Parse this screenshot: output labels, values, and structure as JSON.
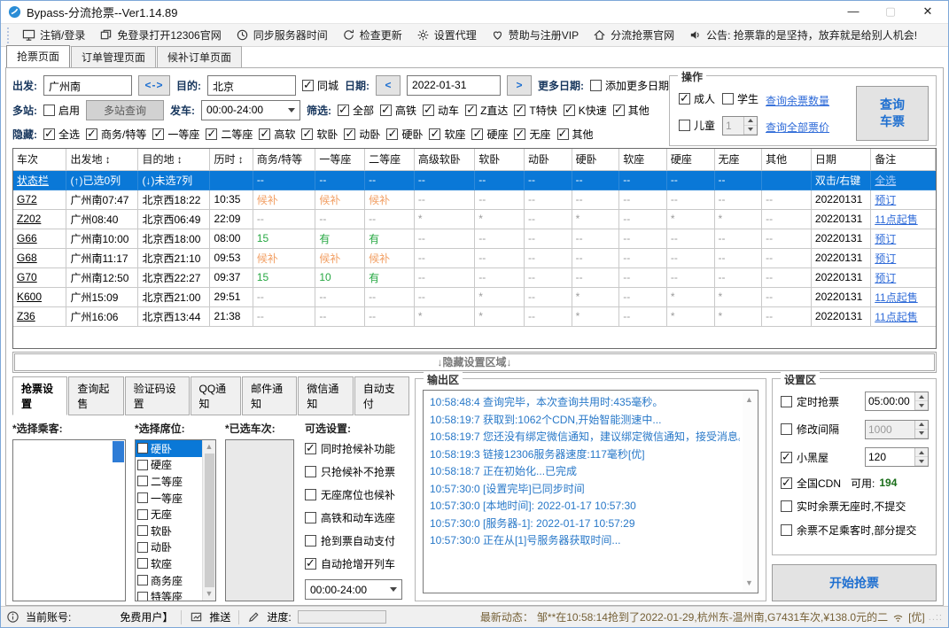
{
  "colors": {
    "accent_blue": "#0a78d7",
    "link_blue": "#2f6bd8",
    "green_avail": "#27a843",
    "orange_waitlist": "#f2a065",
    "label_navy": "#17365d",
    "news_brown": "#756036"
  },
  "window": {
    "title": "Bypass-分流抢票--Ver1.14.89",
    "minimize": "—",
    "maximize": "▢",
    "close": "✕"
  },
  "toolbar": {
    "items": [
      {
        "icon": "monitor",
        "label": "注销/登录"
      },
      {
        "icon": "window",
        "label": "免登录打开12306官网"
      },
      {
        "icon": "clock",
        "label": "同步服务器时间"
      },
      {
        "icon": "refresh",
        "label": "检查更新"
      },
      {
        "icon": "gear",
        "label": "设置代理"
      },
      {
        "icon": "heart",
        "label": "赞助与注册VIP"
      },
      {
        "icon": "home",
        "label": "分流抢票官网"
      },
      {
        "icon": "speaker",
        "label": "公告:  抢票靠的是坚持，放弃就是给别人机会!"
      }
    ]
  },
  "tabs": [
    {
      "label": "抢票页面",
      "active": true
    },
    {
      "label": "订单管理页面",
      "active": false
    },
    {
      "label": "候补订单页面",
      "active": false
    }
  ],
  "query": {
    "depart_label": "出发:",
    "depart_value": "广州南",
    "swap_label": "<->",
    "dest_label": "目的:",
    "dest_value": "北京",
    "same_city": {
      "label": "同城",
      "checked": true
    },
    "date_label": "日期:",
    "date_prev": "<",
    "date_value": "2022-01-31",
    "date_next": ">",
    "more_dates_label": "更多日期:",
    "add_more_dates": {
      "label": "添加更多日期",
      "checked": false
    },
    "multi_label": "多站:",
    "multi_enable": {
      "label": "启用",
      "checked": false
    },
    "multi_query_btn": "多站查询",
    "depart_time_label": "发车:",
    "depart_time_value": "00:00-24:00",
    "filter_label": "筛选:",
    "filters": [
      {
        "label": "全部",
        "checked": true
      },
      {
        "label": "高铁",
        "checked": true
      },
      {
        "label": "动车",
        "checked": true
      },
      {
        "label": "Z直达",
        "checked": true
      },
      {
        "label": "T特快",
        "checked": true
      },
      {
        "label": "K快速",
        "checked": true
      },
      {
        "label": "其他",
        "checked": true
      }
    ],
    "hide_label": "隐藏:",
    "hide_options": [
      {
        "label": "全选",
        "checked": true
      },
      {
        "label": "商务/特等",
        "checked": true
      },
      {
        "label": "一等座",
        "checked": true
      },
      {
        "label": "二等座",
        "checked": true
      },
      {
        "label": "高软",
        "checked": true
      },
      {
        "label": "软卧",
        "checked": true
      },
      {
        "label": "动卧",
        "checked": true
      },
      {
        "label": "硬卧",
        "checked": true
      },
      {
        "label": "软座",
        "checked": true
      },
      {
        "label": "硬座",
        "checked": true
      },
      {
        "label": "无座",
        "checked": true
      },
      {
        "label": "其他",
        "checked": true
      }
    ]
  },
  "operation": {
    "title": "操作",
    "adult": {
      "label": "成人",
      "checked": true
    },
    "student": {
      "label": "学生",
      "checked": false
    },
    "child": {
      "label": "儿童",
      "checked": false
    },
    "child_count": "1",
    "link_check_tickets": "查询余票数量",
    "link_check_prices": "查询全部票价",
    "query_button_line1": "查询",
    "query_button_line2": "车票"
  },
  "table": {
    "headers": [
      "车次",
      "出发地 ↕",
      "目的地 ↕",
      "历时 ↕",
      "商务/特等",
      "一等座",
      "二等座",
      "高级软卧",
      "软卧",
      "动卧",
      "硬卧",
      "软座",
      "硬座",
      "无座",
      "其他",
      "日期",
      "备注"
    ],
    "rows": [
      {
        "selected": true,
        "cells": [
          {
            "t": "状态栏",
            "s": "train"
          },
          {
            "t": "(↑)已选0列"
          },
          {
            "t": "(↓)未选7列"
          },
          {
            "t": ""
          },
          {
            "t": "--"
          },
          {
            "t": "--"
          },
          {
            "t": "--"
          },
          {
            "t": "--"
          },
          {
            "t": "--"
          },
          {
            "t": "--"
          },
          {
            "t": "--"
          },
          {
            "t": "--"
          },
          {
            "t": "--"
          },
          {
            "t": "--"
          },
          {
            "t": ""
          },
          {
            "t": "双击/右键"
          },
          {
            "t": "全选",
            "s": "action"
          }
        ]
      },
      {
        "cells": [
          {
            "t": "G72",
            "s": "train"
          },
          {
            "t": "广州南07:47"
          },
          {
            "t": "北京西18:22"
          },
          {
            "t": "10:35"
          },
          {
            "t": "候补",
            "s": "waitlist"
          },
          {
            "t": "候补",
            "s": "waitlist"
          },
          {
            "t": "候补",
            "s": "waitlist"
          },
          {
            "t": "--",
            "s": "none"
          },
          {
            "t": "--",
            "s": "none"
          },
          {
            "t": "--",
            "s": "none"
          },
          {
            "t": "--",
            "s": "none"
          },
          {
            "t": "--",
            "s": "none"
          },
          {
            "t": "--",
            "s": "none"
          },
          {
            "t": "--",
            "s": "none"
          },
          {
            "t": "--",
            "s": "none"
          },
          {
            "t": "20220131"
          },
          {
            "t": "预订",
            "s": "action"
          }
        ]
      },
      {
        "cells": [
          {
            "t": "Z202",
            "s": "train"
          },
          {
            "t": "广州08:40"
          },
          {
            "t": "北京西06:49"
          },
          {
            "t": "22:09"
          },
          {
            "t": "--",
            "s": "none"
          },
          {
            "t": "--",
            "s": "none"
          },
          {
            "t": "--",
            "s": "none"
          },
          {
            "t": "*",
            "s": "none"
          },
          {
            "t": "*",
            "s": "none"
          },
          {
            "t": "--",
            "s": "none"
          },
          {
            "t": "*",
            "s": "none"
          },
          {
            "t": "--",
            "s": "none"
          },
          {
            "t": "*",
            "s": "none"
          },
          {
            "t": "*",
            "s": "none"
          },
          {
            "t": "--",
            "s": "none"
          },
          {
            "t": "20220131"
          },
          {
            "t": "11点起售",
            "s": "action"
          }
        ]
      },
      {
        "cells": [
          {
            "t": "G66",
            "s": "train"
          },
          {
            "t": "广州南10:00"
          },
          {
            "t": "北京西18:00"
          },
          {
            "t": "08:00"
          },
          {
            "t": "15",
            "s": "avail"
          },
          {
            "t": "有",
            "s": "avail"
          },
          {
            "t": "有",
            "s": "avail"
          },
          {
            "t": "--",
            "s": "none"
          },
          {
            "t": "--",
            "s": "none"
          },
          {
            "t": "--",
            "s": "none"
          },
          {
            "t": "--",
            "s": "none"
          },
          {
            "t": "--",
            "s": "none"
          },
          {
            "t": "--",
            "s": "none"
          },
          {
            "t": "--",
            "s": "none"
          },
          {
            "t": "--",
            "s": "none"
          },
          {
            "t": "20220131"
          },
          {
            "t": "预订",
            "s": "action"
          }
        ]
      },
      {
        "cells": [
          {
            "t": "G68",
            "s": "train"
          },
          {
            "t": "广州南11:17"
          },
          {
            "t": "北京西21:10"
          },
          {
            "t": "09:53"
          },
          {
            "t": "候补",
            "s": "waitlist"
          },
          {
            "t": "候补",
            "s": "waitlist"
          },
          {
            "t": "候补",
            "s": "waitlist"
          },
          {
            "t": "--",
            "s": "none"
          },
          {
            "t": "--",
            "s": "none"
          },
          {
            "t": "--",
            "s": "none"
          },
          {
            "t": "--",
            "s": "none"
          },
          {
            "t": "--",
            "s": "none"
          },
          {
            "t": "--",
            "s": "none"
          },
          {
            "t": "--",
            "s": "none"
          },
          {
            "t": "--",
            "s": "none"
          },
          {
            "t": "20220131"
          },
          {
            "t": "预订",
            "s": "action"
          }
        ]
      },
      {
        "cells": [
          {
            "t": "G70",
            "s": "train"
          },
          {
            "t": "广州南12:50"
          },
          {
            "t": "北京西22:27"
          },
          {
            "t": "09:37"
          },
          {
            "t": "15",
            "s": "avail"
          },
          {
            "t": "10",
            "s": "avail"
          },
          {
            "t": "有",
            "s": "avail"
          },
          {
            "t": "--",
            "s": "none"
          },
          {
            "t": "--",
            "s": "none"
          },
          {
            "t": "--",
            "s": "none"
          },
          {
            "t": "--",
            "s": "none"
          },
          {
            "t": "--",
            "s": "none"
          },
          {
            "t": "--",
            "s": "none"
          },
          {
            "t": "--",
            "s": "none"
          },
          {
            "t": "--",
            "s": "none"
          },
          {
            "t": "20220131"
          },
          {
            "t": "预订",
            "s": "action"
          }
        ]
      },
      {
        "cells": [
          {
            "t": "K600",
            "s": "train"
          },
          {
            "t": "广州15:09"
          },
          {
            "t": "北京西21:00"
          },
          {
            "t": "29:51"
          },
          {
            "t": "--",
            "s": "none"
          },
          {
            "t": "--",
            "s": "none"
          },
          {
            "t": "--",
            "s": "none"
          },
          {
            "t": "--",
            "s": "none"
          },
          {
            "t": "*",
            "s": "none"
          },
          {
            "t": "--",
            "s": "none"
          },
          {
            "t": "*",
            "s": "none"
          },
          {
            "t": "--",
            "s": "none"
          },
          {
            "t": "*",
            "s": "none"
          },
          {
            "t": "*",
            "s": "none"
          },
          {
            "t": "--",
            "s": "none"
          },
          {
            "t": "20220131"
          },
          {
            "t": "11点起售",
            "s": "action"
          }
        ]
      },
      {
        "cells": [
          {
            "t": "Z36",
            "s": "train"
          },
          {
            "t": "广州16:06"
          },
          {
            "t": "北京西13:44"
          },
          {
            "t": "21:38"
          },
          {
            "t": "--",
            "s": "none"
          },
          {
            "t": "--",
            "s": "none"
          },
          {
            "t": "--",
            "s": "none"
          },
          {
            "t": "*",
            "s": "none"
          },
          {
            "t": "*",
            "s": "none"
          },
          {
            "t": "--",
            "s": "none"
          },
          {
            "t": "*",
            "s": "none"
          },
          {
            "t": "--",
            "s": "none"
          },
          {
            "t": "*",
            "s": "none"
          },
          {
            "t": "*",
            "s": "none"
          },
          {
            "t": "--",
            "s": "none"
          },
          {
            "t": "20220131"
          },
          {
            "t": "11点起售",
            "s": "action"
          }
        ]
      }
    ]
  },
  "hide_area_label": "↓隐藏设置区域↓",
  "bottom": {
    "tabs": [
      {
        "label": "抢票设置",
        "active": true
      },
      {
        "label": "查询起售",
        "active": false
      },
      {
        "label": "验证码设置",
        "active": false
      },
      {
        "label": "QQ通知",
        "active": false
      },
      {
        "label": "邮件通知",
        "active": false
      },
      {
        "label": "微信通知",
        "active": false
      },
      {
        "label": "自动支付",
        "active": false
      }
    ],
    "passengers_label": "*选择乘客:",
    "seats_label": "*选择席位:",
    "trains_label": "*已选车次:",
    "options_label": "可选设置:",
    "seats": [
      {
        "label": "硬卧",
        "checked": false,
        "selected": true
      },
      {
        "label": "硬座",
        "checked": false
      },
      {
        "label": "二等座",
        "checked": false
      },
      {
        "label": "一等座",
        "checked": false
      },
      {
        "label": "无座",
        "checked": false
      },
      {
        "label": "软卧",
        "checked": false
      },
      {
        "label": "动卧",
        "checked": false
      },
      {
        "label": "软座",
        "checked": false
      },
      {
        "label": "商务座",
        "checked": false
      },
      {
        "label": "特等座",
        "checked": false
      }
    ],
    "options": [
      {
        "label": "同时抢候补功能",
        "checked": true
      },
      {
        "label": "只抢候补不抢票",
        "checked": false
      },
      {
        "label": "无座席位也候补",
        "checked": false
      },
      {
        "label": "高铁和动车选座",
        "checked": false
      },
      {
        "label": "抢到票自动支付",
        "checked": false
      },
      {
        "label": "自动抢增开列车",
        "checked": true
      }
    ],
    "options_time_value": "00:00-24:00"
  },
  "output": {
    "title": "输出区",
    "lines": [
      "10:58:48:4  查询完毕，本次查询共用时:435毫秒。",
      "10:58:19:7  获取到:1062个CDN,开始智能测速中...",
      "10:58:19:7  您还没有绑定微信通知，建议绑定微信通知，接受消息。",
      "10:58:19:3  链接12306服务器速度:117毫秒[优]",
      "10:58:18:7  正在初始化...已完成",
      "10:57:30:0  [设置完毕]已同步时间",
      "10:57:30:0  [本地时间]: 2022-01-17 10:57:30",
      "10:57:30:0  [服务器-1]: 2022-01-17 10:57:29",
      "10:57:30:0  正在从[1]号服务器获取时间..."
    ]
  },
  "settings": {
    "title": "设置区",
    "timed": {
      "label": "定时抢票",
      "checked": false,
      "value": "05:00:00"
    },
    "interval": {
      "label": "修改间隔",
      "checked": false,
      "value": "1000"
    },
    "blackroom": {
      "label": "小黑屋",
      "checked": true,
      "value": "120"
    },
    "cdn": {
      "label": "全国CDN",
      "checked": true,
      "avail_label": "可用:",
      "avail_value": "194"
    },
    "no_seat": {
      "label": "实时余票无座时,不提交",
      "checked": false
    },
    "partial": {
      "label": "余票不足乘客时,部分提交",
      "checked": false
    },
    "start_button": "开始抢票"
  },
  "statusbar": {
    "account_label": "当前账号:",
    "account_value": "免费用户】",
    "push_label": "推送",
    "progress_label": "进度:",
    "news_label": "最新动态：",
    "news_text": "邹**在10:58:14抢到了2022-01-29,杭州东-温州南,G7431车次,¥138.0元的二",
    "signal_quality": "[优]"
  }
}
